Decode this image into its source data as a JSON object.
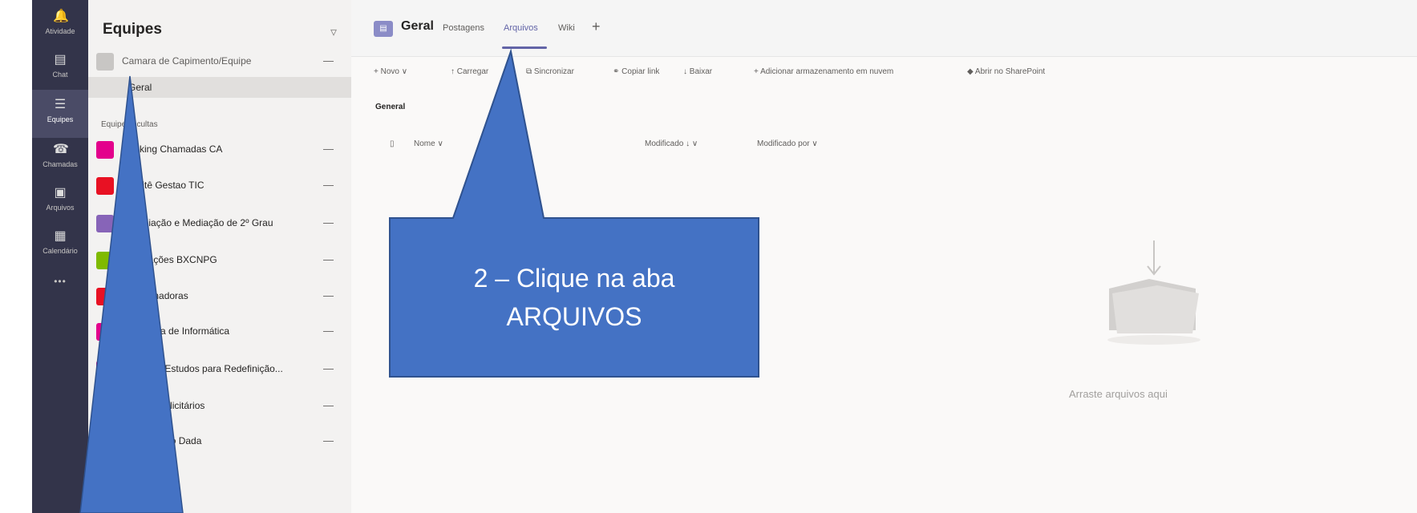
{
  "rail": {
    "items": [
      {
        "label": "Atividade",
        "icon": "bell-icon",
        "glyph": "🔔"
      },
      {
        "label": "Chat",
        "icon": "chat-icon",
        "glyph": "▤"
      },
      {
        "label": "Equipes",
        "icon": "teams-icon",
        "glyph": "☰"
      },
      {
        "label": "Chamadas",
        "icon": "phone-icon",
        "glyph": "☎"
      },
      {
        "label": "Arquivos",
        "icon": "files-icon",
        "glyph": "▣"
      },
      {
        "label": "Calendário",
        "icon": "calendar-icon",
        "glyph": "▦"
      }
    ],
    "more": "•••"
  },
  "teams_panel": {
    "title": "Equipes",
    "filter_icon": "filter-icon",
    "team_top": "Camara de Capimento/Equipe",
    "channel": "Geral",
    "section_label": "Equipes ocultas",
    "teams": [
      {
        "name": "Ranking Chamadas CA",
        "color": "#e3008c"
      },
      {
        "name": "Comitê Gestao TIC",
        "color": "#e81123"
      },
      {
        "name": "Conciliação e Mediação de 2º Grau",
        "color": "#8764b8"
      },
      {
        "name": "Publicações BXCNPG",
        "color": "#7fba00"
      },
      {
        "name": "Coordenadoras",
        "color": "#e81123"
      },
      {
        "name": "Secretaria de Informática",
        "color": "#e3008c"
      },
      {
        "name": "Grupo de Estudos para Redefinição...",
        "color": "#e3008c"
      },
      {
        "name": "Fluxos Publicitários",
        "color": "#e81123"
      },
      {
        "name": "Atendimento Dada",
        "color": "#e81123"
      }
    ],
    "more_glyph": "—"
  },
  "main": {
    "channel_title": "Geral",
    "tabs": [
      "Postagens",
      "Arquivos",
      "Wiki"
    ],
    "active_tab": "Arquivos",
    "add_tab": "+",
    "toolbar": [
      "+ Novo ∨",
      "↑ Carregar",
      "⧉ Sincronizar",
      "⚭ Copiar link",
      "↓ Baixar",
      "+ Adicionar armazenamento em nuvem",
      "◆ Abrir no SharePoint"
    ],
    "breadcrumb": "General",
    "columns": [
      "Nome ∨",
      "Modificado ↓ ∨",
      "Modificado por ∨"
    ],
    "empty_text": "Arraste arquivos aqui"
  },
  "callout": {
    "line1": "2 – Clique na aba",
    "line2": "ARQUIVOS",
    "fill": "#4472c4",
    "stroke": "#2f528f"
  }
}
